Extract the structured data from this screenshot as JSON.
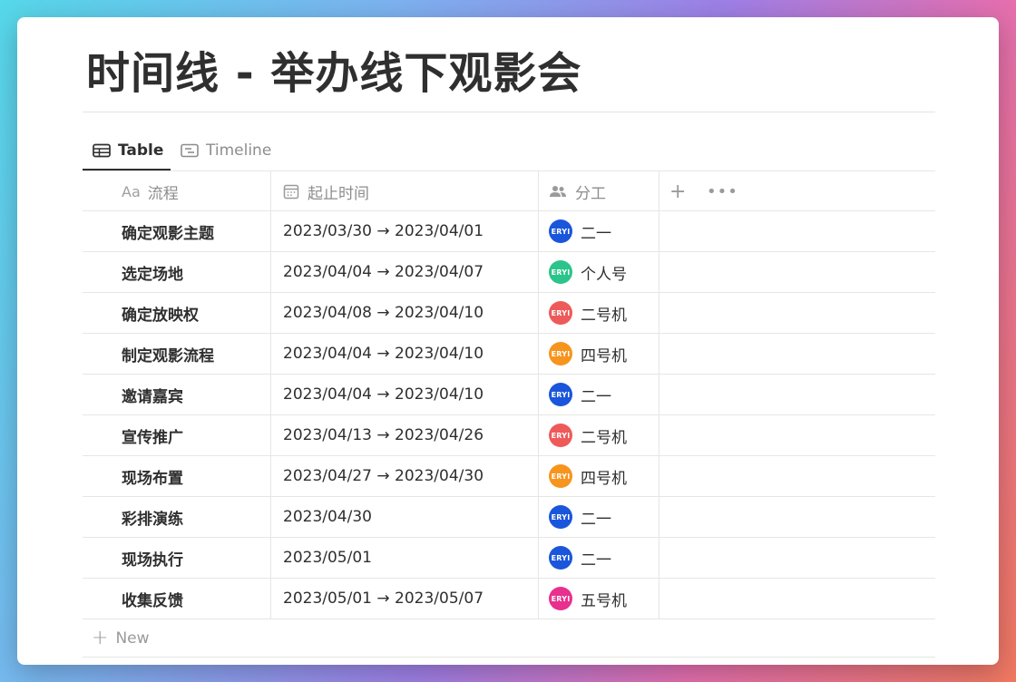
{
  "page": {
    "title": "时间线 - 举办线下观影会"
  },
  "tabs": [
    {
      "label": "Table",
      "icon": "table-icon",
      "active": true
    },
    {
      "label": "Timeline",
      "icon": "timeline-icon",
      "active": false
    }
  ],
  "columns": {
    "name": {
      "prefix": "Aa",
      "label": "流程"
    },
    "dates": {
      "label": "起止时间",
      "icon": "calendar-icon"
    },
    "assignee": {
      "label": "分工",
      "icon": "people-icon"
    },
    "add_label": "+",
    "more_label": "•••"
  },
  "avatar_text": "ERYI",
  "rows": [
    {
      "name": "确定观影主题",
      "dates": "2023/03/30 → 2023/04/01",
      "assignee": "二一",
      "avatar_color": "#1a56db"
    },
    {
      "name": "选定场地",
      "dates": "2023/04/04 → 2023/04/07",
      "assignee": "个人号",
      "avatar_color": "#2bc48a"
    },
    {
      "name": "确定放映权",
      "dates": "2023/04/08 → 2023/04/10",
      "assignee": "二号机",
      "avatar_color": "#ee5a5a"
    },
    {
      "name": "制定观影流程",
      "dates": "2023/04/04 → 2023/04/10",
      "assignee": "四号机",
      "avatar_color": "#f7941d"
    },
    {
      "name": "邀请嘉宾",
      "dates": "2023/04/04 → 2023/04/10",
      "assignee": "二一",
      "avatar_color": "#1a56db"
    },
    {
      "name": "宣传推广",
      "dates": "2023/04/13 → 2023/04/26",
      "assignee": "二号机",
      "avatar_color": "#ee5a5a"
    },
    {
      "name": "现场布置",
      "dates": "2023/04/27 → 2023/04/30",
      "assignee": "四号机",
      "avatar_color": "#f7941d"
    },
    {
      "name": "彩排演练",
      "dates": "2023/04/30",
      "assignee": "二一",
      "avatar_color": "#1a56db"
    },
    {
      "name": "现场执行",
      "dates": "2023/05/01",
      "assignee": "二一",
      "avatar_color": "#1a56db"
    },
    {
      "name": "收集反馈",
      "dates": "2023/05/01 → 2023/05/07",
      "assignee": "五号机",
      "avatar_color": "#e8308e"
    }
  ],
  "new_row": {
    "label": "New"
  }
}
